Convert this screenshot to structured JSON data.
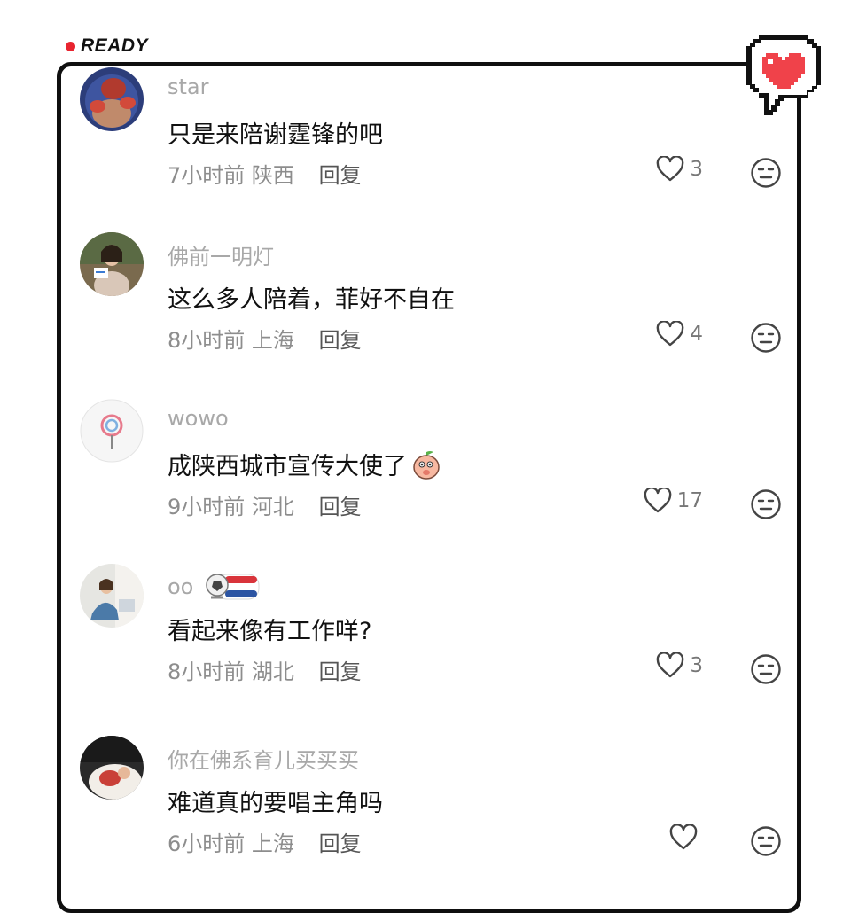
{
  "badge": {
    "text": "READY",
    "dot_color": "#e8242f",
    "heart_color": "#f0424a"
  },
  "comments": [
    {
      "username": "star",
      "text": "只是来陪谢霆锋的吧",
      "time": "7小时前",
      "location": "陕西",
      "reply": "回复",
      "likes": "3",
      "avatar": "avatar-boxer"
    },
    {
      "username": "佛前一明灯",
      "text": "这么多人陪着，菲好不自在",
      "time": "8小时前",
      "location": "上海",
      "reply": "回复",
      "likes": "4",
      "avatar": "avatar-woman-sign"
    },
    {
      "username": "wowo",
      "text": "成陕西城市宣传大使了",
      "time": "9小时前",
      "location": "河北",
      "reply": "回复",
      "likes": "17",
      "avatar": "avatar-lollipop",
      "emoji": "peach-emoji"
    },
    {
      "username": "oo",
      "text": "看起来像有工作咩?",
      "time": "8小时前",
      "location": "湖北",
      "reply": "回复",
      "likes": "3",
      "avatar": "avatar-girl-sitting",
      "badge": "netherlands-football-badge"
    },
    {
      "username": "你在佛系育儿买买买",
      "text": "难道真的要唱主角吗",
      "time": "6小时前",
      "location": "上海",
      "reply": "回复",
      "likes": "",
      "avatar": "avatar-baby"
    }
  ]
}
